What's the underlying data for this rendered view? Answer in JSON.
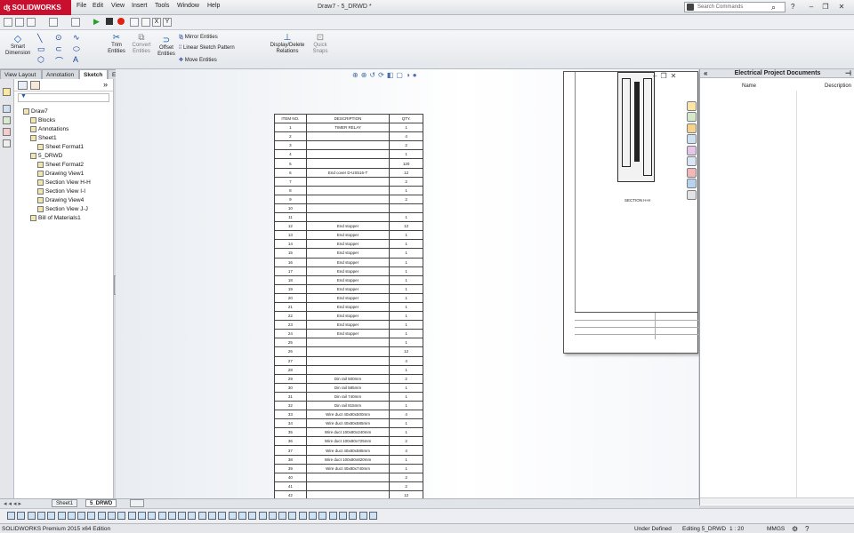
{
  "app": {
    "logo_text": "SOLIDWORKS",
    "doc_title": "Draw7 - 5_DRWD *"
  },
  "menus": [
    "File",
    "Edit",
    "View",
    "Insert",
    "Tools",
    "Window",
    "Help"
  ],
  "search": {
    "placeholder": "Search Commands"
  },
  "ribbon": {
    "smart_dimension": "Smart Dimension",
    "trim": "Trim Entities",
    "convert": "Convert Entities",
    "offset": "Offset Entities",
    "mirror": "Mirror Entities",
    "linear_pattern": "Linear Sketch Pattern",
    "move": "Move Entities",
    "display_delete": "Display/Delete Relations",
    "quick_snaps": "Quick Snaps"
  },
  "tabs": [
    "View Layout",
    "Annotation",
    "Sketch",
    "Evaluate",
    "SOLIDWORKS Electrical Drawing",
    "PSI"
  ],
  "active_tab": "Sketch",
  "tree": [
    {
      "label": "Draw7",
      "indent": 0
    },
    {
      "label": "Blocks",
      "indent": 1
    },
    {
      "label": "Annotations",
      "indent": 1
    },
    {
      "label": "Sheet1",
      "indent": 1
    },
    {
      "label": "Sheet Format1",
      "indent": 2
    },
    {
      "label": "5_DRWD",
      "indent": 1
    },
    {
      "label": "Sheet Format2",
      "indent": 2
    },
    {
      "label": "Drawing View1",
      "indent": 2
    },
    {
      "label": "Section View H-H",
      "indent": 2
    },
    {
      "label": "Section View I-I",
      "indent": 2
    },
    {
      "label": "Drawing View4",
      "indent": 2
    },
    {
      "label": "Section View J-J",
      "indent": 2
    },
    {
      "label": "Bill of Materials1",
      "indent": 1
    }
  ],
  "bom": {
    "headers": [
      "ITEM NO.",
      "DESCRIPTION",
      "QTY."
    ],
    "rows": [
      [
        "1",
        "TIMER RELAY",
        "1"
      ],
      [
        "2",
        "",
        "4"
      ],
      [
        "3",
        "",
        "2"
      ],
      [
        "4",
        "",
        "1"
      ],
      [
        "5",
        "",
        "120"
      ],
      [
        "6",
        "End cover D-US516-T",
        "12"
      ],
      [
        "7",
        "",
        "2"
      ],
      [
        "8",
        "",
        "1"
      ],
      [
        "9",
        "",
        "2"
      ],
      [
        "10",
        "",
        ""
      ],
      [
        "11",
        "",
        "1"
      ],
      [
        "12",
        "End stopper",
        "12"
      ],
      [
        "13",
        "End stopper",
        "1"
      ],
      [
        "14",
        "End stopper",
        "1"
      ],
      [
        "15",
        "End stopper",
        "1"
      ],
      [
        "16",
        "End stopper",
        "1"
      ],
      [
        "17",
        "End stopper",
        "1"
      ],
      [
        "18",
        "End stopper",
        "1"
      ],
      [
        "19",
        "End stopper",
        "1"
      ],
      [
        "20",
        "End stopper",
        "1"
      ],
      [
        "21",
        "End stopper",
        "1"
      ],
      [
        "22",
        "End stopper",
        "1"
      ],
      [
        "23",
        "End stopper",
        "1"
      ],
      [
        "24",
        "End stopper",
        "1"
      ],
      [
        "25",
        "",
        "1"
      ],
      [
        "26",
        "",
        "12"
      ],
      [
        "27",
        "",
        "4"
      ],
      [
        "28",
        "",
        "1"
      ],
      [
        "29",
        "Din rail 500mm",
        "2"
      ],
      [
        "30",
        "Din rail 585mm",
        "1"
      ],
      [
        "31",
        "Din rail 740mm",
        "1"
      ],
      [
        "32",
        "Din rail 815mm",
        "1"
      ],
      [
        "33",
        "Wire duct 40x80x500mm",
        "4"
      ],
      [
        "34",
        "Wire duct 40x80x585mm",
        "1"
      ],
      [
        "35",
        "Wire duct 100x80x240mm",
        "1"
      ],
      [
        "36",
        "Wire duct 100x80x725mm",
        "2"
      ],
      [
        "37",
        "Wire duct 40x80x585mm",
        "4"
      ],
      [
        "38",
        "Wire duct 100x80x820mm",
        "1"
      ],
      [
        "39",
        "Wire duct 40x80x740mm",
        "1"
      ],
      [
        "40",
        "",
        "2"
      ],
      [
        "41",
        "",
        "2"
      ],
      [
        "42",
        "",
        "12"
      ]
    ]
  },
  "sheet": {
    "section_label": "SECTION H-H"
  },
  "taskpane": {
    "title": "Electrical Project Documents",
    "col_name": "Name",
    "col_desc": "Description"
  },
  "sheet_tabs": [
    "Sheet1",
    "5_DRWD"
  ],
  "active_sheet": "5_DRWD",
  "status": {
    "edition": "SOLIDWORKS Premium 2015 x64 Edition",
    "state": "Under Defined",
    "editing": "Editing 5_DRWD",
    "scale": "1 : 20",
    "units": "MMGS"
  }
}
